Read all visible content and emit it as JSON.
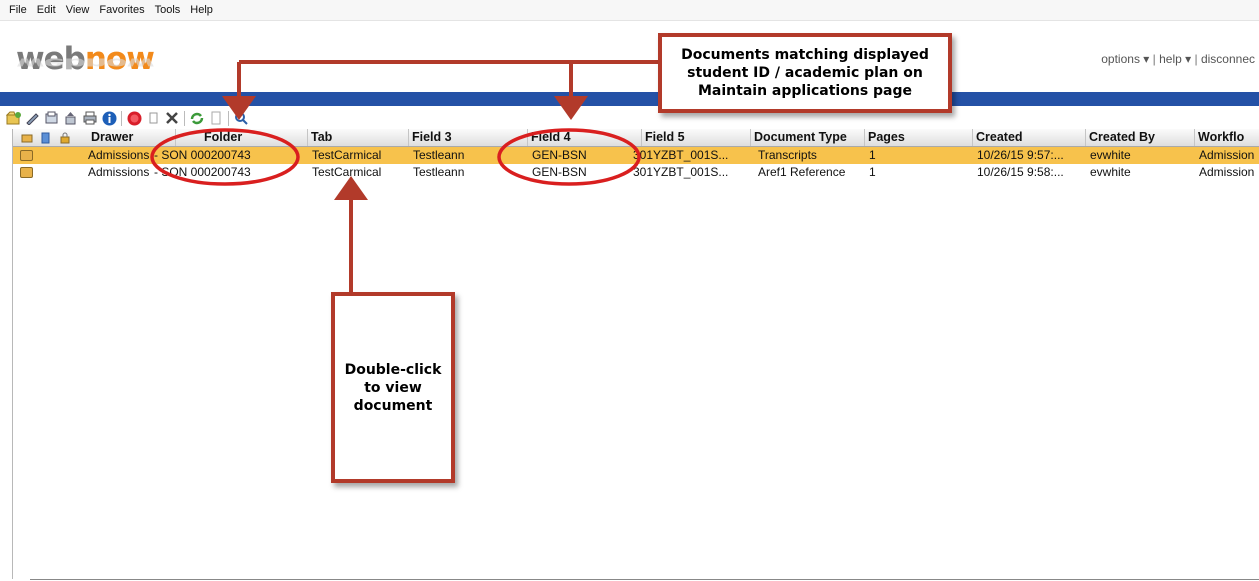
{
  "menu": [
    "File",
    "Edit",
    "View",
    "Favorites",
    "Tools",
    "Help"
  ],
  "logo": {
    "part1": "web",
    "part2": "now"
  },
  "top_links": {
    "options": "options ▾",
    "sep1": " | ",
    "help": "help ▾",
    "sep2": " | ",
    "disconnect": "disconnec"
  },
  "toolbar_icons": [
    "new-document-icon",
    "edit-icon",
    "scan-icon",
    "upload-icon",
    "print-icon",
    "info-icon",
    "stop-icon",
    "copy-icon",
    "delete-icon",
    "refresh-icon",
    "blank-page-icon",
    "search-icon"
  ],
  "grid": {
    "icon_columns": [
      "document-icon",
      "notes-icon",
      "lock-icon"
    ],
    "columns": [
      "Drawer",
      "Folder",
      "Tab",
      "Field 3",
      "Field 4",
      "Field 5",
      "Document Type",
      "Pages",
      "Created",
      "Created By",
      "Workflo"
    ],
    "rows": [
      {
        "drawer": "Admissions",
        "folder": "- SON 000200743",
        "tab": "TestCarmical",
        "field3": "Testleann",
        "field4": "GEN-BSN",
        "field5": "301YZBT_001S...",
        "doc_type": "Transcripts",
        "pages": "1",
        "created": "10/26/15 9:57:...",
        "created_by": "evwhite",
        "workflow": "Admission"
      },
      {
        "drawer": "Admissions",
        "folder": "- SON 000200743",
        "tab": "TestCarmical",
        "field3": "Testleann",
        "field4": "GEN-BSN",
        "field5": "301YZBT_001S...",
        "doc_type": "Aref1 Reference",
        "pages": "1",
        "created": "10/26/15 9:58:...",
        "created_by": "evwhite",
        "workflow": "Admission"
      }
    ]
  },
  "annotations": {
    "top": "Documents matching displayed student ID / academic plan on Maintain applications page",
    "bottom": "Double-click to view document"
  },
  "colors": {
    "accent_blue": "#2451a6",
    "selected_row": "#f7c24c",
    "annotation_red": "#b23a2a",
    "logo_orange": "#f28a1b",
    "logo_gray": "#7a7a7a"
  }
}
